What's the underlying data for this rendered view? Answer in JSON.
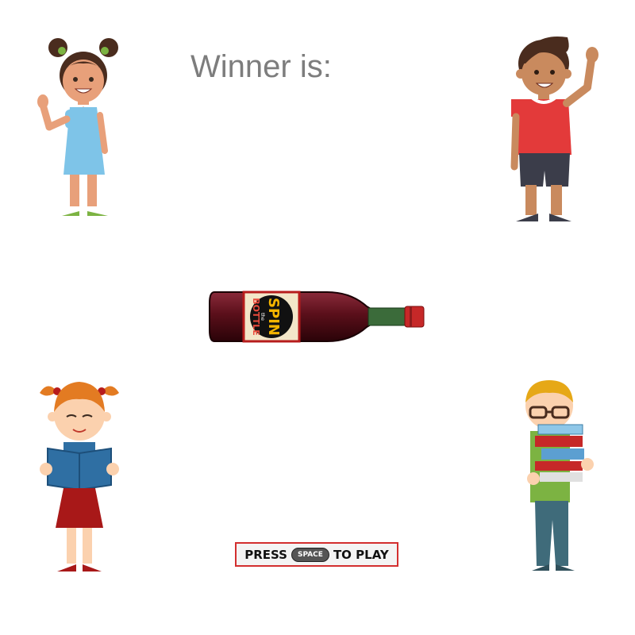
{
  "game": {
    "winner_label": "Winner is:",
    "bottle_label_top": "SPIN",
    "bottle_label_mid": "the",
    "bottle_label_bottom": "BOTTLE",
    "press_prefix": "PRESS",
    "press_key": "SPACE",
    "press_suffix": "TO PLAY"
  },
  "players": [
    {
      "id": "girl-blue-dress",
      "icon": "waving-girl-icon"
    },
    {
      "id": "boy-red-shirt",
      "icon": "waving-boy-icon"
    },
    {
      "id": "girl-reading",
      "icon": "reading-girl-icon"
    },
    {
      "id": "boy-with-books",
      "icon": "boy-books-icon"
    }
  ],
  "colors": {
    "banner_border": "#d32f2f",
    "bottle_wine": "#5a0f1a",
    "title_text": "#7d7d7d"
  }
}
